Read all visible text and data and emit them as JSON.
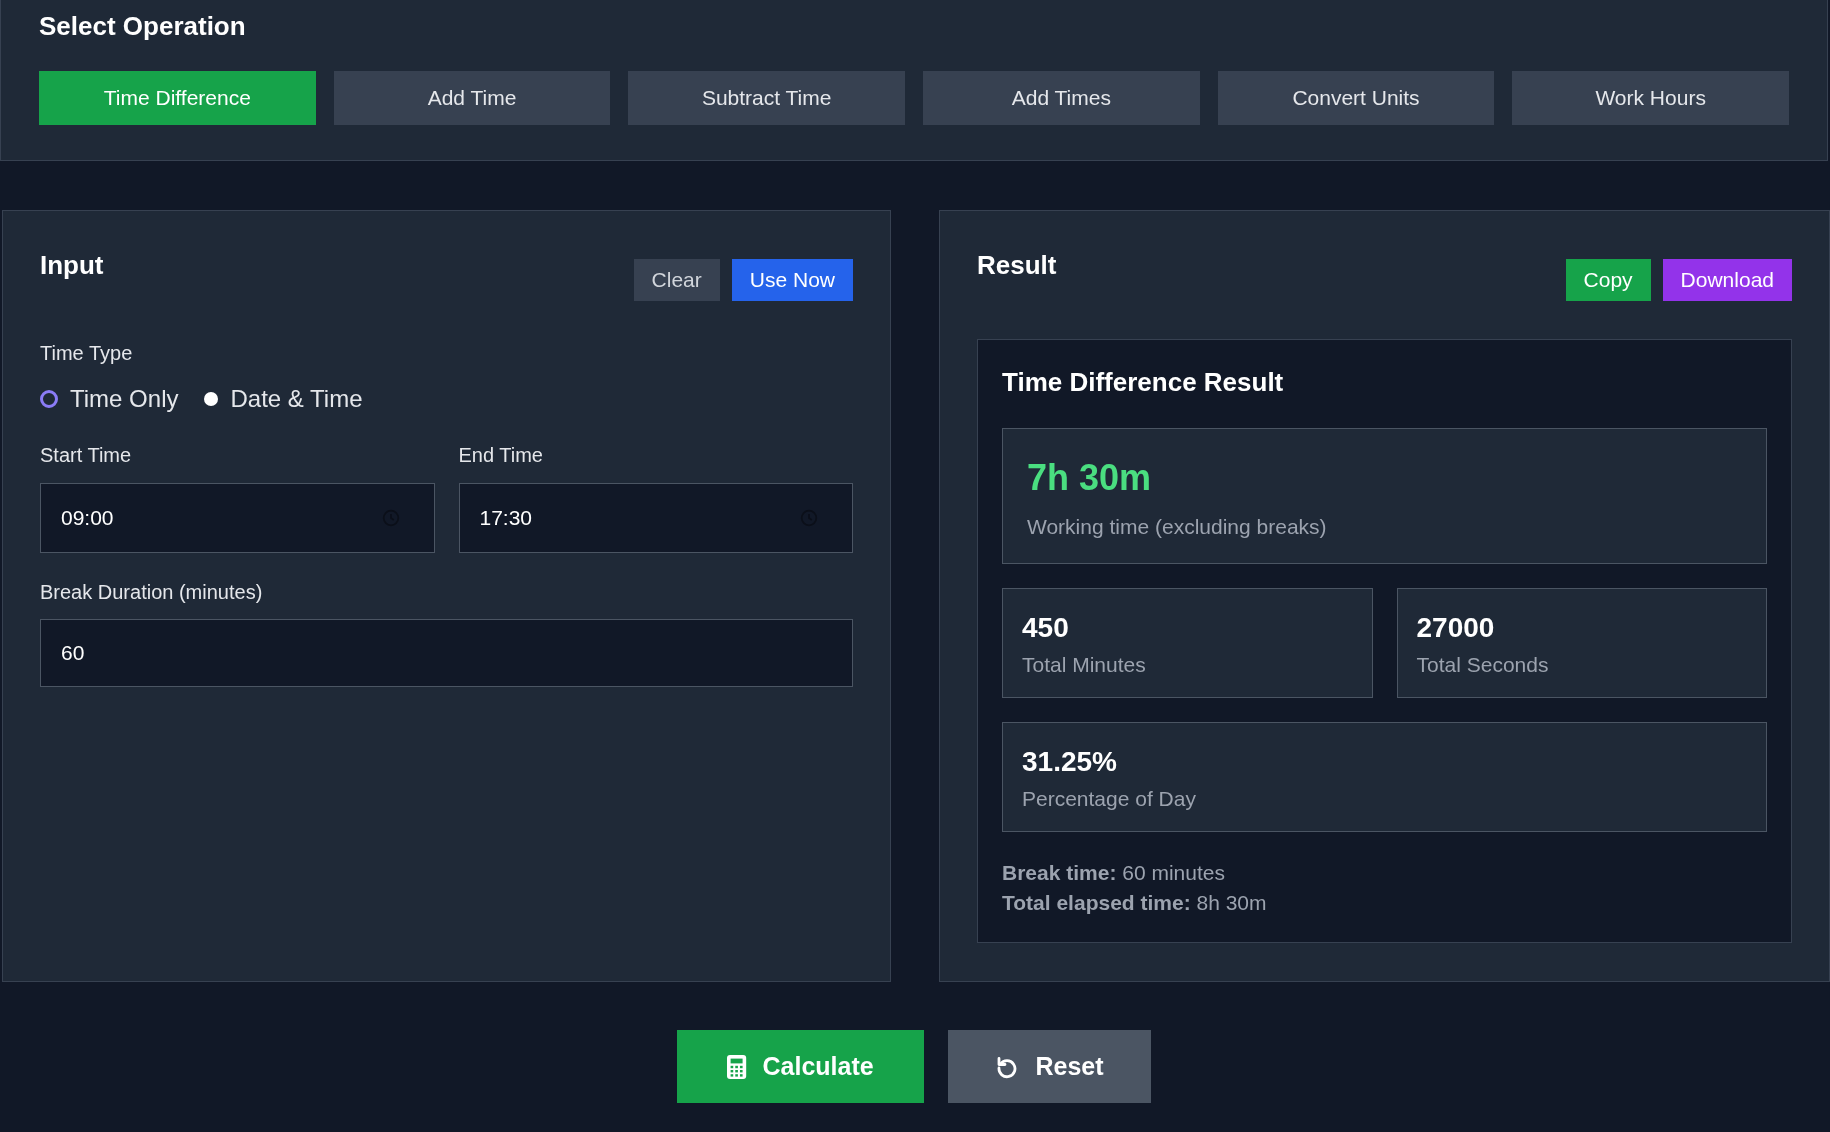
{
  "operations": {
    "title": "Select Operation",
    "items": [
      {
        "label": "Time Difference",
        "selected": true
      },
      {
        "label": "Add Time",
        "selected": false
      },
      {
        "label": "Subtract Time",
        "selected": false
      },
      {
        "label": "Add Times",
        "selected": false
      },
      {
        "label": "Convert Units",
        "selected": false
      },
      {
        "label": "Work Hours",
        "selected": false
      }
    ]
  },
  "input": {
    "title": "Input",
    "buttons": [
      {
        "label": "Clear",
        "kind": "secondary"
      },
      {
        "label": "Use Now",
        "kind": "primary"
      }
    ],
    "time_type": {
      "label": "Time Type",
      "options": [
        {
          "label": "Time Only",
          "selected": true
        },
        {
          "label": "Date & Time",
          "selected": false
        }
      ]
    },
    "fields": [
      {
        "label": "Start Time",
        "value": "09:00",
        "kind": "time"
      },
      {
        "label": "End Time",
        "value": "17:30",
        "kind": "time"
      }
    ],
    "break": {
      "label": "Break Duration (minutes)",
      "value": "60"
    }
  },
  "result": {
    "title": "Result",
    "buttons": [
      {
        "label": "Copy",
        "kind": "success"
      },
      {
        "label": "Download",
        "kind": "accent"
      }
    ],
    "card": {
      "title": "Time Difference Result",
      "main": {
        "value": "7h 30m",
        "label": "Working time (excluding breaks)"
      },
      "stats": [
        {
          "value": "450",
          "label": "Total Minutes",
          "kind": "half"
        },
        {
          "value": "27000",
          "label": "Total Seconds",
          "kind": "half"
        },
        {
          "value": "31.25%",
          "label": "Percentage of Day",
          "kind": "full"
        }
      ],
      "notes": [
        "**Break time:** 60 minutes",
        "**Total elapsed time:** 8h 30m"
      ]
    }
  },
  "actions": [
    {
      "label": "Calculate",
      "kind": "calculate"
    },
    {
      "label": "Reset",
      "kind": "reset"
    }
  ]
}
